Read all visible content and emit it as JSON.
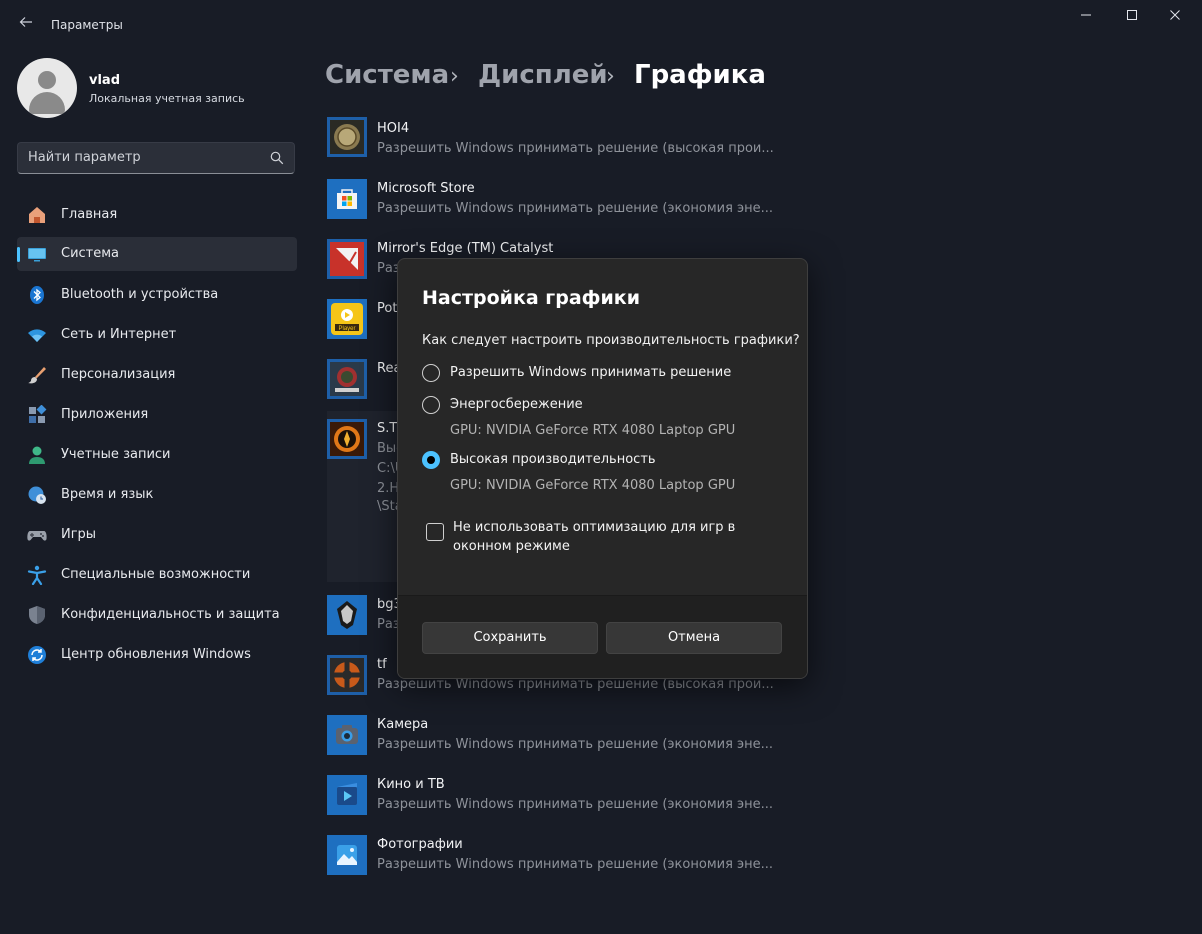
{
  "window": {
    "title": "Параметры",
    "back_icon": "arrow-left-icon",
    "minimize_icon": "minimize-icon",
    "maximize_icon": "maximize-icon",
    "close_icon": "close-icon"
  },
  "profile": {
    "name": "vlad",
    "account_type": "Локальная учетная запись"
  },
  "search": {
    "placeholder": "Найти параметр",
    "icon": "search-icon"
  },
  "sidebar": {
    "accent_color": "#4cc2ff",
    "items": [
      {
        "label": "Главная",
        "icon": "home-icon",
        "active": false
      },
      {
        "label": "Система",
        "icon": "system-icon",
        "active": true
      },
      {
        "label": "Bluetooth и устройства",
        "icon": "bluetooth-icon",
        "active": false
      },
      {
        "label": "Сеть и Интернет",
        "icon": "wifi-icon",
        "active": false
      },
      {
        "label": "Персонализация",
        "icon": "brush-icon",
        "active": false
      },
      {
        "label": "Приложения",
        "icon": "apps-icon",
        "active": false
      },
      {
        "label": "Учетные записи",
        "icon": "accounts-icon",
        "active": false
      },
      {
        "label": "Время и язык",
        "icon": "time-language-icon",
        "active": false
      },
      {
        "label": "Игры",
        "icon": "gamepad-icon",
        "active": false
      },
      {
        "label": "Специальные возможности",
        "icon": "accessibility-icon",
        "active": false
      },
      {
        "label": "Конфиденциальность и защита",
        "icon": "shield-icon",
        "active": false
      },
      {
        "label": "Центр обновления Windows",
        "icon": "update-icon",
        "active": false
      }
    ]
  },
  "breadcrumb": {
    "items": [
      "Система",
      "Дисплей",
      "Графика"
    ],
    "separator": "›"
  },
  "apps": [
    {
      "name": "HOI4",
      "status": "Разрешить Windows принимать решение (высокая прои...",
      "icon": "hoi4-icon"
    },
    {
      "name": "Microsoft Store",
      "status": "Разрешить Windows принимать решение (экономия эне...",
      "icon": "microsoft-store-icon"
    },
    {
      "name": "Mirror's Edge (TM) Catalyst",
      "status": "Раз",
      "icon": "mirrors-edge-icon"
    },
    {
      "name": "Pot",
      "status": "",
      "icon": "potplayer-icon"
    },
    {
      "name": "Rea",
      "status": "",
      "icon": "ready-or-not-icon"
    },
    {
      "name": "S.T.",
      "status": "Выс",
      "icon": "stalker-icon",
      "expanded_lines": [
        "C:\\U",
        "2.H",
        "\\Sta"
      ]
    },
    {
      "name": "bg3",
      "status": "Раз",
      "icon": "bg3-icon"
    },
    {
      "name": "tf",
      "status": "Разрешить Windows принимать решение (высокая прои...",
      "icon": "tf2-icon"
    },
    {
      "name": "Камера",
      "status": "Разрешить Windows принимать решение (экономия эне...",
      "icon": "camera-icon"
    },
    {
      "name": "Кино и ТВ",
      "status": "Разрешить Windows принимать решение (экономия эне...",
      "icon": "movies-tv-icon"
    },
    {
      "name": "Фотографии",
      "status": "Разрешить Windows принимать решение (экономия эне...",
      "icon": "photos-icon"
    }
  ],
  "dialog": {
    "title": "Настройка графики",
    "question": "Как следует настроить производительность графики?",
    "options": [
      {
        "label": "Разрешить Windows принимать решение",
        "gpu": "",
        "selected": false
      },
      {
        "label": "Энергосбережение",
        "gpu": "GPU: NVIDIA GeForce RTX 4080 Laptop GPU",
        "selected": false
      },
      {
        "label": "Высокая производительность",
        "gpu": "GPU: NVIDIA GeForce RTX 4080 Laptop GPU",
        "selected": true
      }
    ],
    "checkbox": {
      "label": "Не использовать оптимизацию для игр в оконном режиме",
      "checked": false
    },
    "save_label": "Сохранить",
    "cancel_label": "Отмена"
  }
}
